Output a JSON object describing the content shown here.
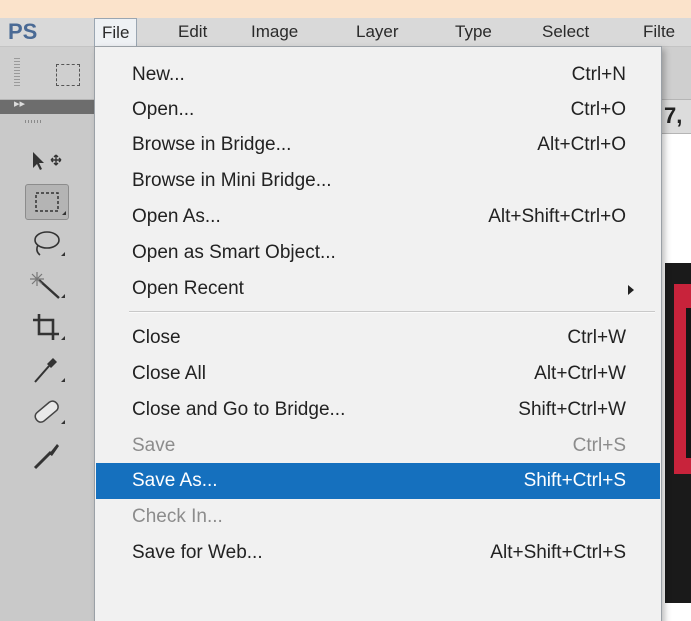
{
  "app": {
    "logo": "PS"
  },
  "menubar": {
    "items": [
      {
        "label": "File",
        "active": true
      },
      {
        "label": "Edit"
      },
      {
        "label": "Image"
      },
      {
        "label": "Layer"
      },
      {
        "label": "Type"
      },
      {
        "label": "Select"
      },
      {
        "label": "Filte"
      }
    ]
  },
  "document": {
    "tab_text": "7,"
  },
  "file_menu": {
    "items": [
      {
        "label": "New...",
        "shortcut": "Ctrl+N"
      },
      {
        "label": "Open...",
        "shortcut": "Ctrl+O"
      },
      {
        "label": "Browse in Bridge...",
        "shortcut": "Alt+Ctrl+O"
      },
      {
        "label": "Browse in Mini Bridge...",
        "shortcut": ""
      },
      {
        "label": "Open As...",
        "shortcut": "Alt+Shift+Ctrl+O"
      },
      {
        "label": "Open as Smart Object...",
        "shortcut": ""
      },
      {
        "label": "Open Recent",
        "shortcut": "",
        "submenu": true
      },
      {
        "label": "Close",
        "shortcut": "Ctrl+W"
      },
      {
        "label": "Close All",
        "shortcut": "Alt+Ctrl+W"
      },
      {
        "label": "Close and Go to Bridge...",
        "shortcut": "Shift+Ctrl+W"
      },
      {
        "label": "Save",
        "shortcut": "Ctrl+S",
        "disabled": true
      },
      {
        "label": "Save As...",
        "shortcut": "Shift+Ctrl+S",
        "highlighted": true
      },
      {
        "label": "Check In...",
        "shortcut": "",
        "disabled": true
      },
      {
        "label": "Save for Web...",
        "shortcut": "Alt+Shift+Ctrl+S"
      }
    ]
  },
  "tools": [
    {
      "name": "move-tool"
    },
    {
      "name": "rectangular-marquee-tool",
      "selected": true
    },
    {
      "name": "lasso-tool"
    },
    {
      "name": "magic-wand-tool"
    },
    {
      "name": "crop-tool"
    },
    {
      "name": "eyedropper-tool"
    },
    {
      "name": "healing-brush-tool"
    },
    {
      "name": "brush-tool"
    }
  ],
  "colors": {
    "highlight": "#1570be",
    "background": "#fbe3cb",
    "logo": "#4a6a95"
  }
}
